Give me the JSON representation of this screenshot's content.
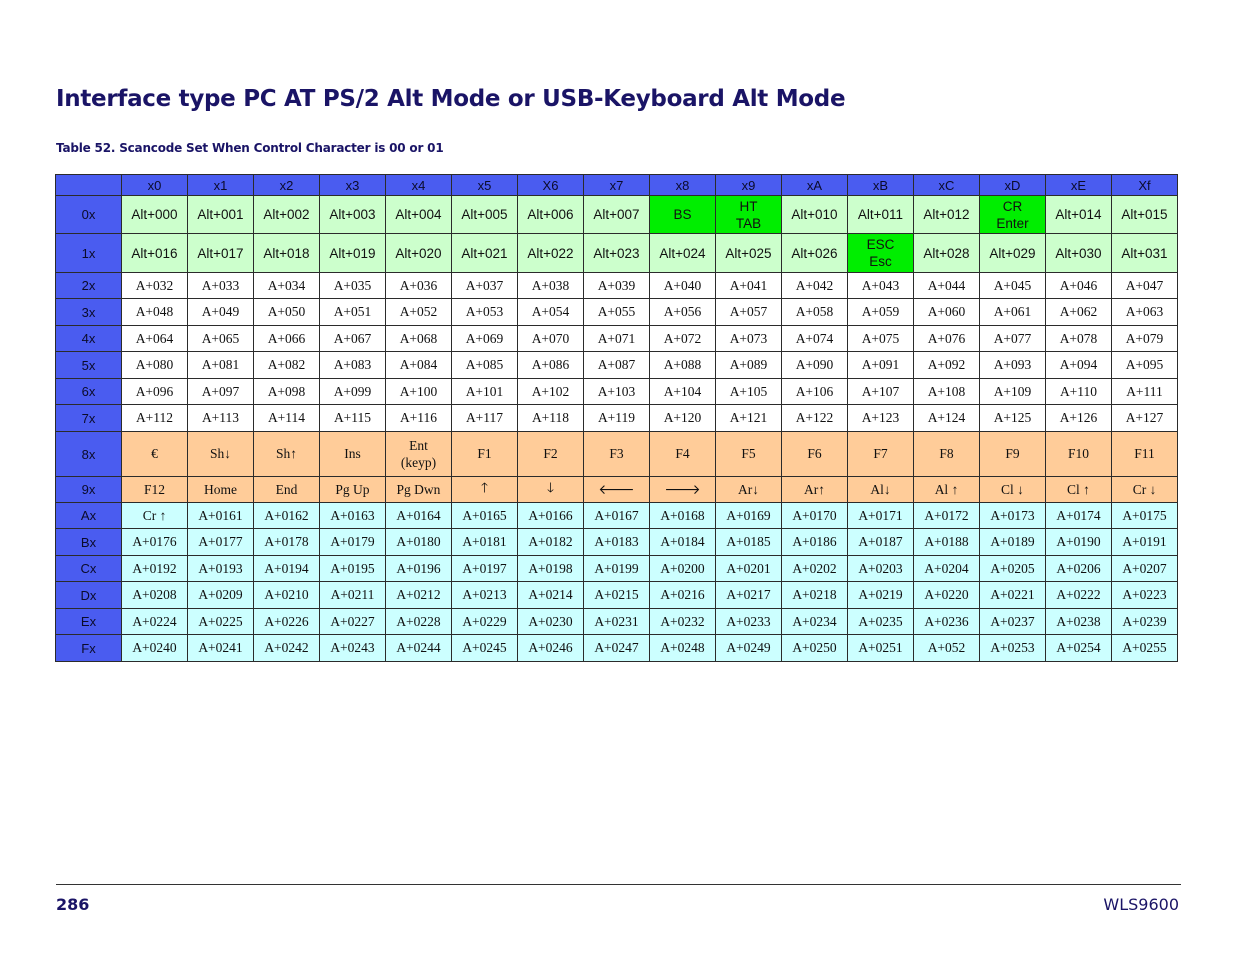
{
  "title": "Interface type PC AT PS/2 Alt Mode or USB-Keyboard Alt Mode",
  "caption": "Table 52. Scancode Set When Control Character is 00 or 01",
  "table": {
    "column_headers": [
      "x0",
      "x1",
      "x2",
      "x3",
      "x4",
      "x5",
      "X6",
      "x7",
      "x8",
      "x9",
      "xA",
      "xB",
      "xC",
      "xD",
      "xE",
      "Xf"
    ],
    "rows": [
      {
        "header": "0x",
        "cells": [
          "Alt+000",
          "Alt+001",
          "Alt+002",
          "Alt+003",
          "Alt+004",
          "Alt+005",
          "Alt+006",
          "Alt+007",
          "BS",
          "HT\nTAB",
          "Alt+010",
          "Alt+011",
          "Alt+012",
          "CR\nEnter",
          "Alt+014",
          "Alt+015"
        ]
      },
      {
        "header": "1x",
        "cells": [
          "Alt+016",
          "Alt+017",
          "Alt+018",
          "Alt+019",
          "Alt+020",
          "Alt+021",
          "Alt+022",
          "Alt+023",
          "Alt+024",
          "Alt+025",
          "Alt+026",
          "ESC\nEsc",
          "Alt+028",
          "Alt+029",
          "Alt+030",
          "Alt+031"
        ]
      },
      {
        "header": "2x",
        "cells": [
          "A+032",
          "A+033",
          "A+034",
          "A+035",
          "A+036",
          "A+037",
          "A+038",
          "A+039",
          "A+040",
          "A+041",
          "A+042",
          "A+043",
          "A+044",
          "A+045",
          "A+046",
          "A+047"
        ]
      },
      {
        "header": "3x",
        "cells": [
          "A+048",
          "A+049",
          "A+050",
          "A+051",
          "A+052",
          "A+053",
          "A+054",
          "A+055",
          "A+056",
          "A+057",
          "A+058",
          "A+059",
          "A+060",
          "A+061",
          "A+062",
          "A+063"
        ]
      },
      {
        "header": "4x",
        "cells": [
          "A+064",
          "A+065",
          "A+066",
          "A+067",
          "A+068",
          "A+069",
          "A+070",
          "A+071",
          "A+072",
          "A+073",
          "A+074",
          "A+075",
          "A+076",
          "A+077",
          "A+078",
          "A+079"
        ]
      },
      {
        "header": "5x",
        "cells": [
          "A+080",
          "A+081",
          "A+082",
          "A+083",
          "A+084",
          "A+085",
          "A+086",
          "A+087",
          "A+088",
          "A+089",
          "A+090",
          "A+091",
          "A+092",
          "A+093",
          "A+094",
          "A+095"
        ]
      },
      {
        "header": "6x",
        "cells": [
          "A+096",
          "A+097",
          "A+098",
          "A+099",
          "A+100",
          "A+101",
          "A+102",
          "A+103",
          "A+104",
          "A+105",
          "A+106",
          "A+107",
          "A+108",
          "A+109",
          "A+110",
          "A+111"
        ]
      },
      {
        "header": "7x",
        "cells": [
          "A+112",
          "A+113",
          "A+114",
          "A+115",
          "A+116",
          "A+117",
          "A+118",
          "A+119",
          "A+120",
          "A+121",
          "A+122",
          "A+123",
          "A+124",
          "A+125",
          "A+126",
          "A+127"
        ]
      },
      {
        "header": "8x",
        "cells": [
          "€",
          "Sh↓",
          "Sh↑",
          "Ins",
          "Ent\n(keyp)",
          "F1",
          "F2",
          "F3",
          "F4",
          "F5",
          "F6",
          "F7",
          "F8",
          "F9",
          "F10",
          "F11"
        ]
      },
      {
        "header": "9x",
        "cells": [
          "F12",
          "Home",
          "End",
          "Pg Up",
          "Pg Dwn",
          "🡑",
          "🡓",
          "🡐",
          "🡒",
          "Ar↓",
          "Ar↑",
          "Al↓",
          "Al ↑",
          "Cl ↓",
          "Cl ↑",
          "Cr ↓"
        ]
      },
      {
        "header": "Ax",
        "cells": [
          "Cr ↑",
          "A+0161",
          "A+0162",
          "A+0163",
          "A+0164",
          "A+0165",
          "A+0166",
          "A+0167",
          "A+0168",
          "A+0169",
          "A+0170",
          "A+0171",
          "A+0172",
          "A+0173",
          "A+0174",
          "A+0175"
        ]
      },
      {
        "header": "Bx",
        "cells": [
          "A+0176",
          "A+0177",
          "A+0178",
          "A+0179",
          "A+0180",
          "A+0181",
          "A+0182",
          "A+0183",
          "A+0184",
          "A+0185",
          "A+0186",
          "A+0187",
          "A+0188",
          "A+0189",
          "A+0190",
          "A+0191"
        ]
      },
      {
        "header": "Cx",
        "cells": [
          "A+0192",
          "A+0193",
          "A+0194",
          "A+0195",
          "A+0196",
          "A+0197",
          "A+0198",
          "A+0199",
          "A+0200",
          "A+0201",
          "A+0202",
          "A+0203",
          "A+0204",
          "A+0205",
          "A+0206",
          "A+0207"
        ]
      },
      {
        "header": "Dx",
        "cells": [
          "A+0208",
          "A+0209",
          "A+0210",
          "A+0211",
          "A+0212",
          "A+0213",
          "A+0214",
          "A+0215",
          "A+0216",
          "A+0217",
          "A+0218",
          "A+0219",
          "A+0220",
          "A+0221",
          "A+0222",
          "A+0223"
        ]
      },
      {
        "header": "Ex",
        "cells": [
          "A+0224",
          "A+0225",
          "A+0226",
          "A+0227",
          "A+0228",
          "A+0229",
          "A+0230",
          "A+0231",
          "A+0232",
          "A+0233",
          "A+0234",
          "A+0235",
          "A+0236",
          "A+0237",
          "A+0238",
          "A+0239"
        ]
      },
      {
        "header": "Fx",
        "cells": [
          "A+0240",
          "A+0241",
          "A+0242",
          "A+0243",
          "A+0244",
          "A+0245",
          "A+0246",
          "A+0247",
          "A+0248",
          "A+0249",
          "A+0250",
          "A+0251",
          "A+052",
          "A+0253",
          "A+0254",
          "A+0255"
        ]
      }
    ]
  },
  "footer": {
    "page_number": "286",
    "doc_id": "WLS9600"
  },
  "colors": {
    "header_blue": "#4a5cf0",
    "light_green": "#ccffcc",
    "bright_green": "#00ee00",
    "orange": "#ffcc99",
    "cyan": "#ccffff",
    "title_navy": "#1a1466"
  }
}
